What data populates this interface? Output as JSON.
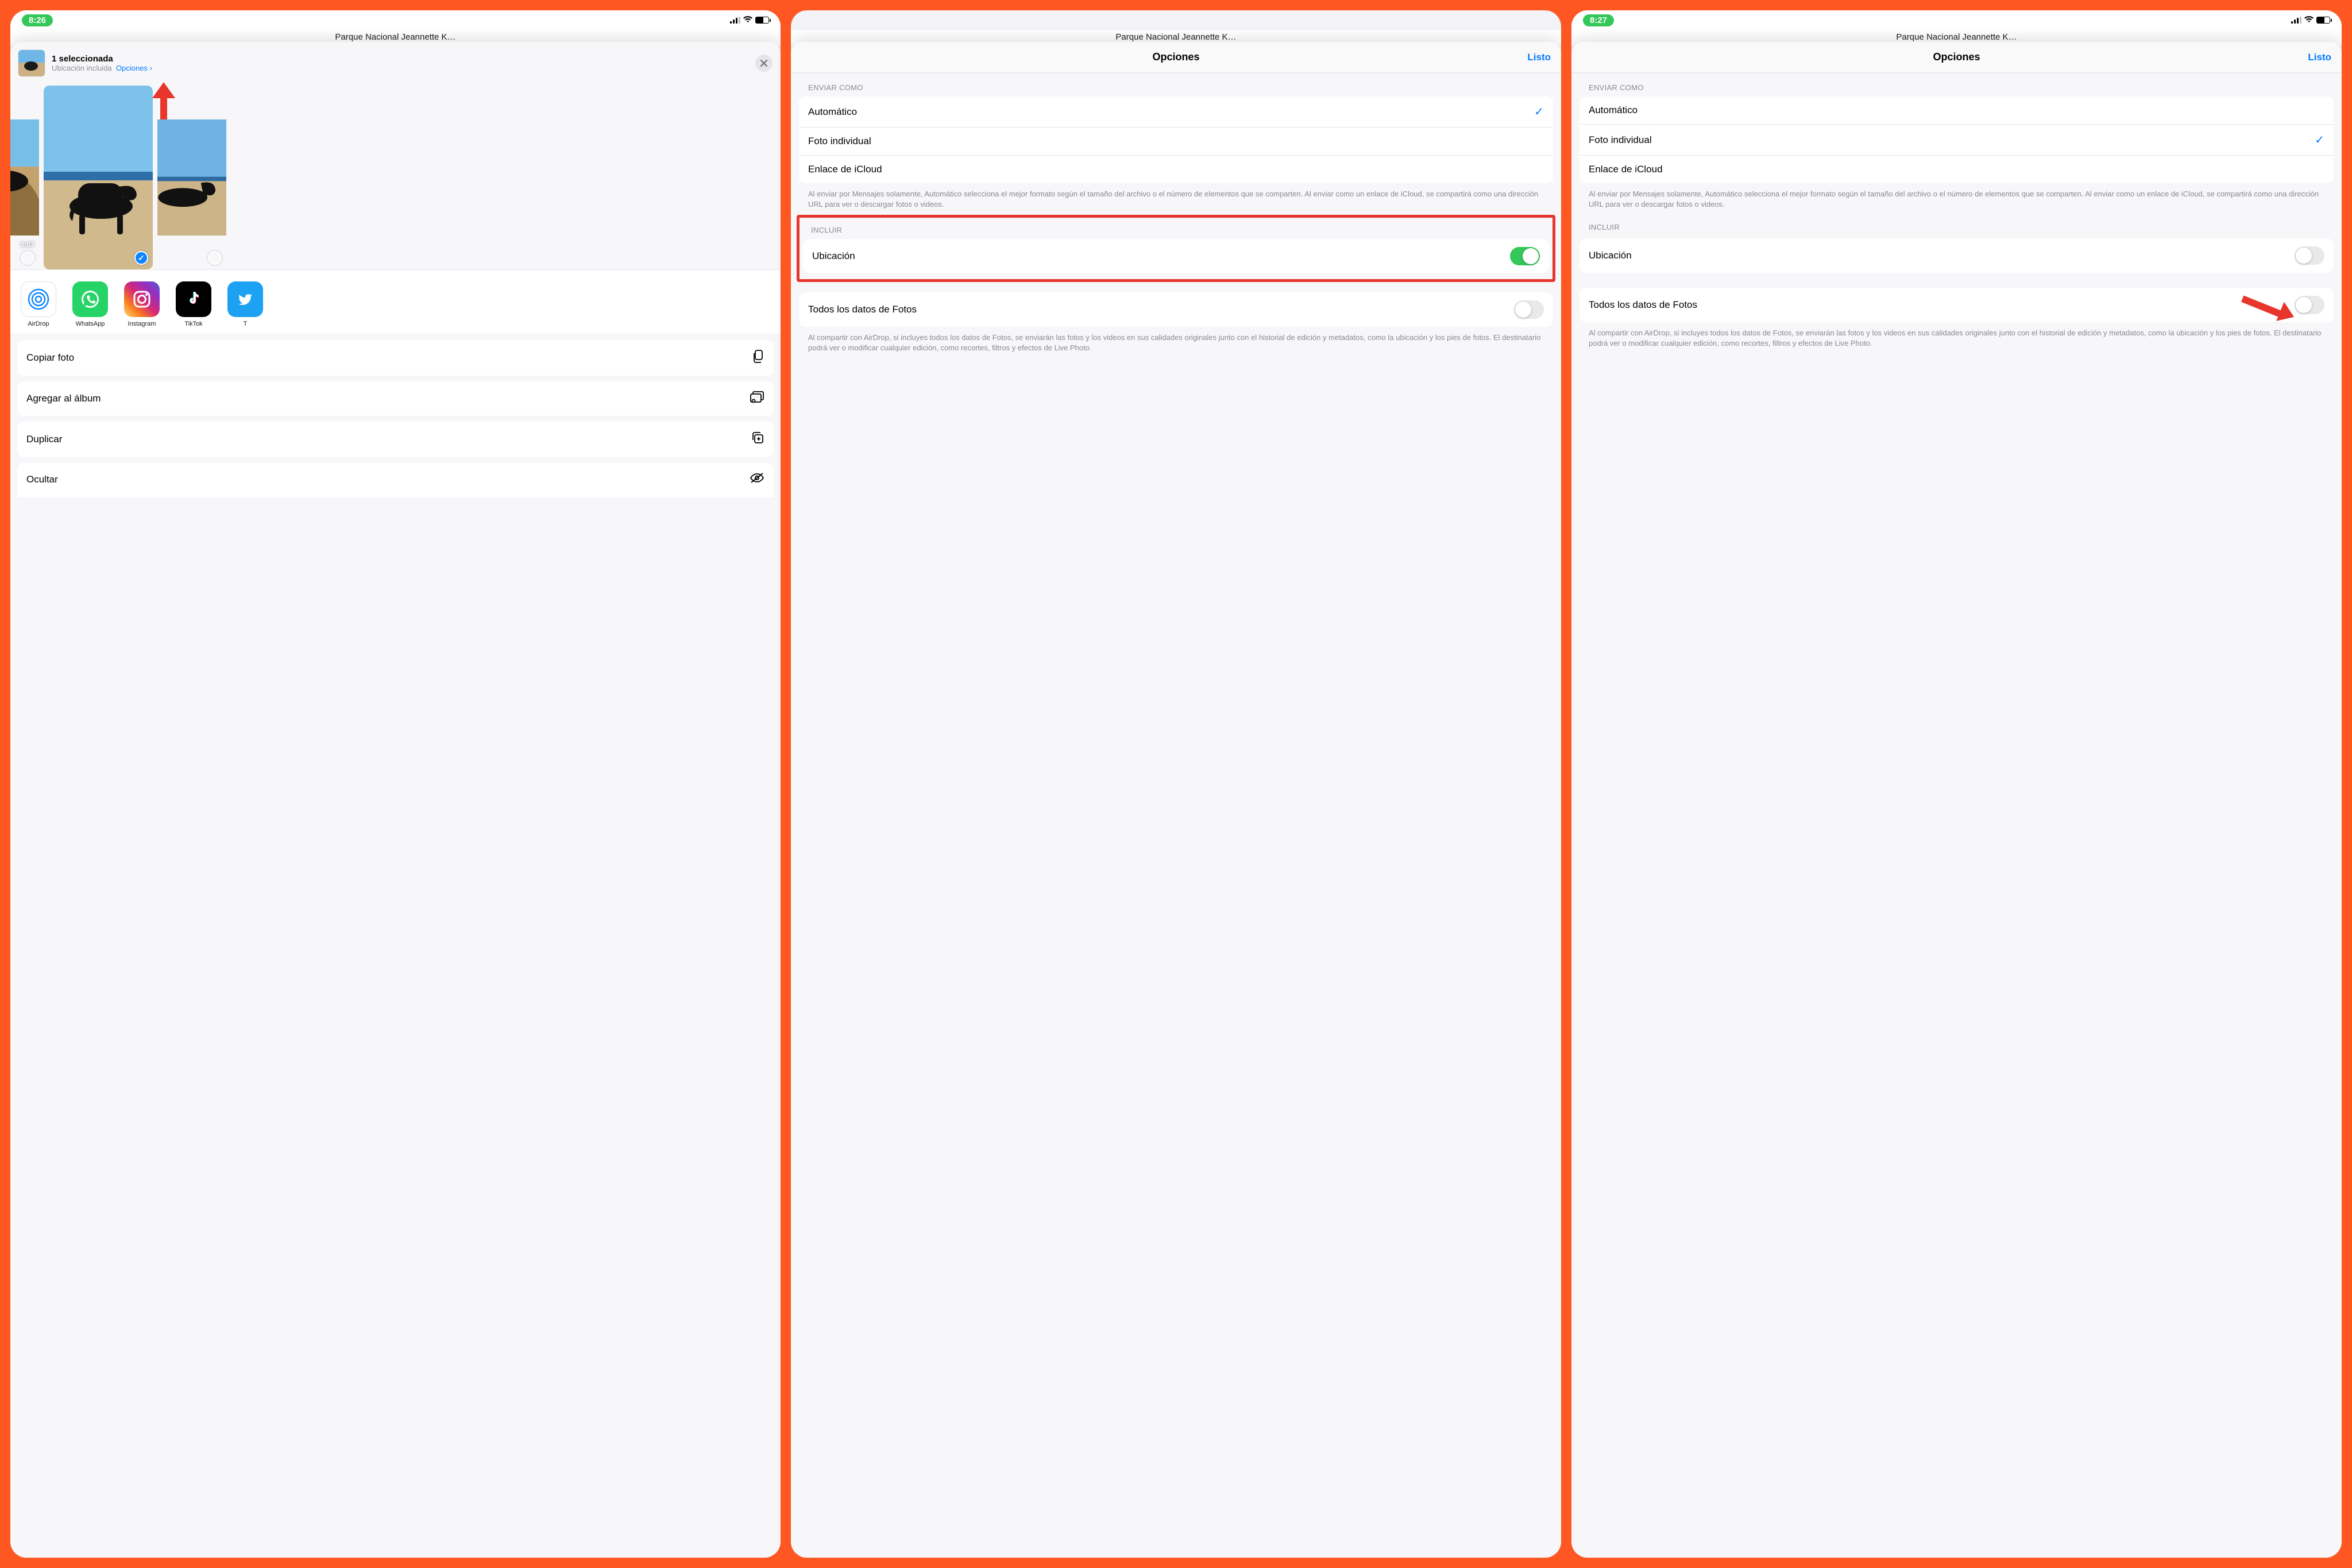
{
  "status": {
    "time1": "8:26",
    "time3": "8:27"
  },
  "bgTitle": "Parque Nacional Jeannette K…",
  "share": {
    "selected_title": "1 seleccionada",
    "location_sub": "Ubicación incluida",
    "options_link": "Opciones",
    "chevron": "›",
    "video_duration": "0:07",
    "apps": {
      "airdrop": "AirDrop",
      "whatsapp": "WhatsApp",
      "instagram": "Instagram",
      "tiktok": "TikTok",
      "twitter_initial": "T"
    },
    "actions": {
      "copy": "Copiar foto",
      "add_album": "Agregar al álbum",
      "duplicate": "Duplicar",
      "hide": "Ocultar"
    }
  },
  "options": {
    "header_title": "Opciones",
    "done": "Listo",
    "send_as_label": "ENVIAR COMO",
    "send_as": {
      "auto": "Automático",
      "individual": "Foto individual",
      "icloud": "Enlace de iCloud"
    },
    "send_as_footer": "Al enviar por Mensajes solamente, Automático selecciona el mejor formato según el tamaño del archivo o el número de elementos que se comparten. Al enviar como un enlace de iCloud, se compartirá como una dirección URL para ver o descargar fotos o videos.",
    "include_label": "INCLUIR",
    "location": "Ubicación",
    "all_data": "Todos los datos de Fotos",
    "all_data_footer": "Al compartir con AirDrop, si incluyes todos los datos de Fotos, se enviarán las fotos y los videos en sus calidades originales junto con el historial de edición y metadatos, como la ubicación y los pies de fotos. El destinatario podrá ver o modificar cualquier edición, como recortes, filtros y efectos de Live Photo."
  }
}
